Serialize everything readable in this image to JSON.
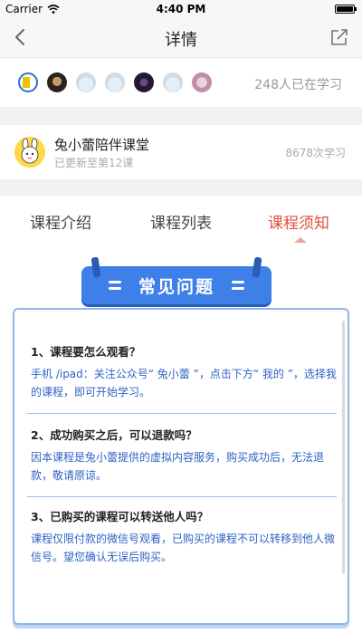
{
  "status_bar": {
    "carrier": "Carrier",
    "time": "4:40 PM"
  },
  "nav": {
    "title": "详情",
    "back_icon": "chevron-left-icon",
    "share_icon": "share-icon"
  },
  "learners": {
    "count_text": "248人已在学习",
    "avatar_count": 7
  },
  "course": {
    "name": "兔小蕾陪伴课堂",
    "subtitle": "已更新至第12课",
    "stat": "8678次学习"
  },
  "tabs": [
    {
      "label": "课程介绍",
      "active": false
    },
    {
      "label": "课程列表",
      "active": false
    },
    {
      "label": "课程须知",
      "active": true
    }
  ],
  "colors": {
    "accent": "#e0503c",
    "banner": "#3e7fe8",
    "answer": "#2f62c5"
  },
  "faq": {
    "banner_title": "常见问题",
    "items": [
      {
        "question": "1、课程要怎么观看？",
        "answer": "手机 /ipad：关注公众号“ 兔小蕾 ”，点击下方“ 我的 ”，选择我的课程，即可开始学习。"
      },
      {
        "question": "2、成功购买之后，可以退款吗？",
        "answer": "因本课程是兔小蕾提供的虚拟内容服务，购买成功后，无法退款，敬请原谅。"
      },
      {
        "question": "3、已购买的课程可以转送他人吗？",
        "answer": "课程仅限付款的微信号观看，已购买的课程不可以转移到他人微信号。望您确认无误后购买。"
      }
    ]
  }
}
